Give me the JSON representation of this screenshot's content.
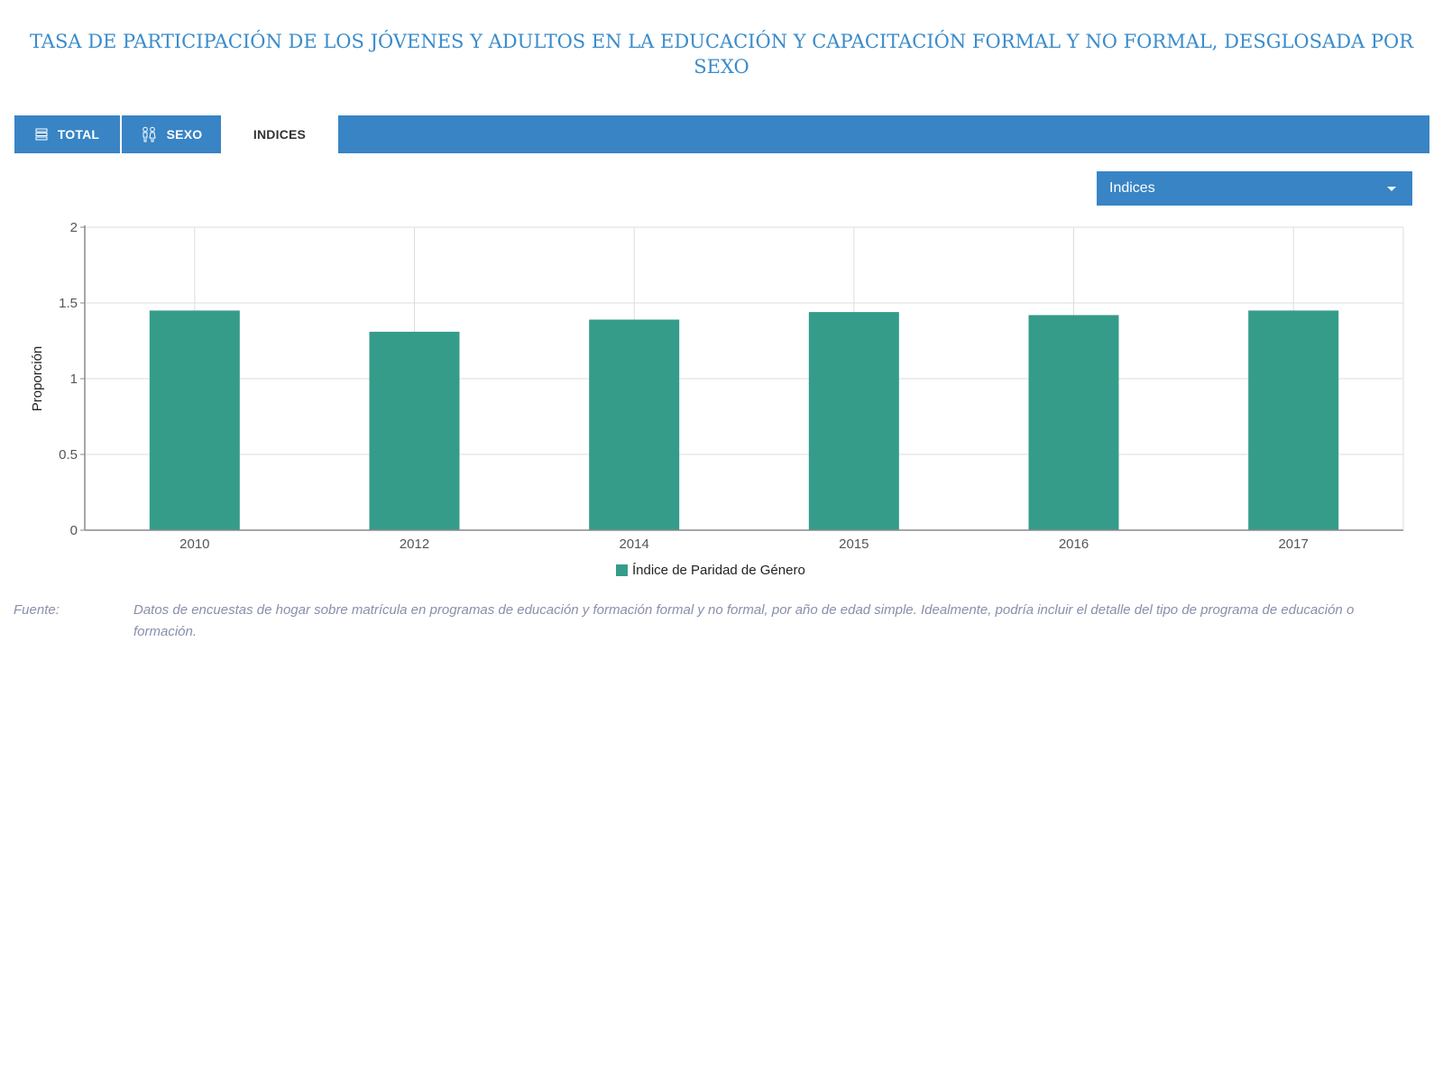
{
  "title": "TASA DE PARTICIPACIÓN DE LOS JÓVENES Y ADULTOS EN LA EDUCACIÓN Y CAPACITACIÓN FORMAL Y NO FORMAL, DESGLOSADA POR SEXO",
  "tabs": [
    {
      "label": "TOTAL",
      "icon": "list-icon",
      "active": false
    },
    {
      "label": "SEXO",
      "icon": "gender-icon",
      "active": false
    },
    {
      "label": "INDICES",
      "active": true
    }
  ],
  "dropdown": {
    "selected": "Indices"
  },
  "colors": {
    "accent": "#3884c5",
    "title": "#3a8ccb",
    "bar": "#359c8a"
  },
  "chart_data": {
    "type": "bar",
    "categories": [
      "2010",
      "2012",
      "2014",
      "2015",
      "2016",
      "2017"
    ],
    "series": [
      {
        "name": "Índice de Paridad de Género",
        "values": [
          1.45,
          1.31,
          1.39,
          1.44,
          1.42,
          1.45
        ],
        "color": "#359c8a"
      }
    ],
    "ylabel": "Proporción",
    "xlabel": "",
    "ylim": [
      0,
      2
    ],
    "yticks": [
      "0",
      "0.5",
      "1",
      "1.5",
      "2"
    ],
    "grid": true,
    "legend": "bottom-center"
  },
  "source": {
    "label": "Fuente:",
    "text": "Datos de encuestas de hogar sobre matrícula en programas de educación y formación formal y no formal, por año de edad simple. Idealmente, podría incluir el detalle del tipo de programa de educación o formación."
  }
}
